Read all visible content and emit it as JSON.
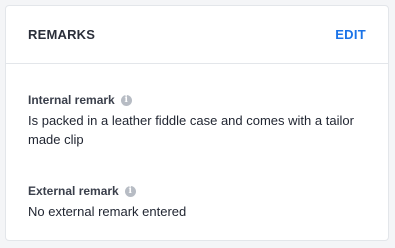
{
  "card": {
    "title": "REMARKS",
    "edit_label": "EDIT"
  },
  "internal_remark": {
    "label": "Internal remark",
    "info_icon": "info-icon",
    "value": "Is packed in a leather fiddle case and comes with a tailor made clip"
  },
  "external_remark": {
    "label": "External remark",
    "info_icon": "info-icon",
    "value": "No external remark entered"
  },
  "colors": {
    "accent": "#1a73e8",
    "icon_gray": "#b7bcc4",
    "border": "#e3e6ea"
  }
}
